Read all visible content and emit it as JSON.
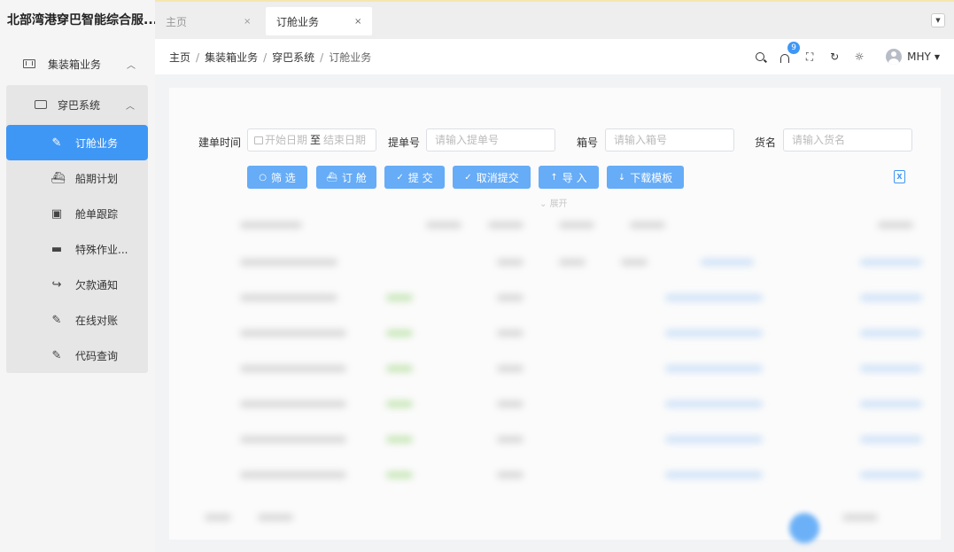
{
  "app": {
    "title": "北部湾港穿巴智能综合服..."
  },
  "sidebar": {
    "top_item": {
      "label": "集装箱业务",
      "icon": "container-icon",
      "expanded": true
    },
    "group": {
      "label": "穿巴系统",
      "icon": "truck-icon",
      "expanded": true
    },
    "items": [
      {
        "label": "订舱业务",
        "icon": "edit-icon",
        "active": true
      },
      {
        "label": "船期计划",
        "icon": "ship-icon",
        "active": false
      },
      {
        "label": "舱单跟踪",
        "icon": "clipboard-icon",
        "active": false
      },
      {
        "label": "特殊作业...",
        "icon": "beta-icon",
        "active": false
      },
      {
        "label": "欠款通知",
        "icon": "share-icon",
        "active": false
      },
      {
        "label": "在线对账",
        "icon": "edit-icon",
        "active": false
      },
      {
        "label": "代码查询",
        "icon": "edit-icon",
        "active": false
      }
    ]
  },
  "tabs": [
    {
      "label": "主页",
      "close": "×",
      "active": false
    },
    {
      "label": "订舱业务",
      "close": "×",
      "active": true
    }
  ],
  "header": {
    "breadcrumb": [
      "主页",
      "集装箱业务",
      "穿巴系统",
      "订舱业务"
    ],
    "separator": "/",
    "notification_count": "9",
    "user": "MHY"
  },
  "filters": {
    "created_time_label": "建单时间",
    "start_placeholder": "开始日期",
    "range_sep": "至",
    "end_placeholder": "结束日期",
    "bill_label": "提单号",
    "bill_placeholder": "请输入提单号",
    "box_label": "箱号",
    "box_placeholder": "请输入箱号",
    "goods_label": "货名",
    "goods_placeholder": "请输入货名"
  },
  "actions": {
    "filter": "筛 选",
    "book": "订 舱",
    "submit": "提 交",
    "cancel_submit": "取消提交",
    "import": "导 入",
    "download_template": "下载模板",
    "expand": "展开"
  },
  "colors": {
    "accent": "#3f97f5",
    "button": "#66acf7",
    "sidebar_bg": "#f5f5f5"
  }
}
